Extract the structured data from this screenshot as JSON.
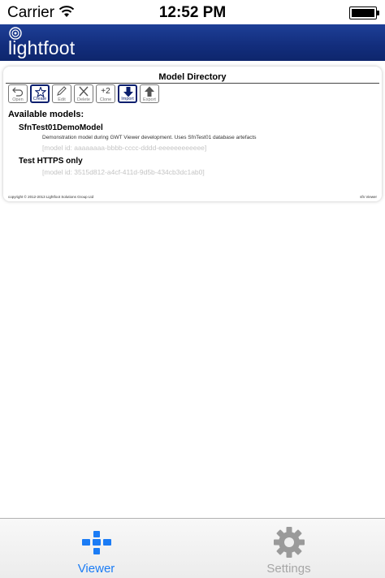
{
  "status_bar": {
    "carrier": "Carrier",
    "time": "12:52 PM"
  },
  "header": {
    "logo_text": "lightfoot"
  },
  "page": {
    "title": "Model Directory"
  },
  "toolbar": {
    "buttons": [
      {
        "label": "Open",
        "icon": "undo-arrow-icon",
        "active": false
      },
      {
        "label": "Create",
        "icon": "star-icon",
        "active": true
      },
      {
        "label": "Edit",
        "icon": "pencil-icon",
        "active": false
      },
      {
        "label": "Delete",
        "icon": "x-icon",
        "active": false
      },
      {
        "label": "Clone",
        "icon": "plus-two-icon",
        "glyph": "+2",
        "active": false
      },
      {
        "label": "Import",
        "icon": "down-arrow-icon",
        "active": true
      },
      {
        "label": "Export",
        "icon": "up-arrow-icon",
        "active": false
      }
    ]
  },
  "models": {
    "heading": "Available models:",
    "items": [
      {
        "name": "SfnTest01DemoModel",
        "description": "Demonstration model during GWT Viewer development. Uses SfnTest01 database artefacts",
        "model_id": "[model id: aaaaaaaa-bbbb-cccc-dddd-eeeeeeeeeeee]"
      },
      {
        "name": "Test HTTPS only",
        "description": "",
        "model_id": "[model id: 3515d812-a4cf-411d-9d5b-434cb3dc1ab0]"
      }
    ]
  },
  "footer": {
    "copyright": "copyright © 2012-2013 Lightfoot Solutions Group Ltd",
    "app_name": "sfn Viewer"
  },
  "tabbar": {
    "tabs": [
      {
        "label": "Viewer",
        "icon": "viewer-grid-icon",
        "selected": true
      },
      {
        "label": "Settings",
        "icon": "gear-icon",
        "selected": false
      }
    ]
  },
  "colors": {
    "header_blue": "#1a3a8f",
    "tab_selected": "#1b7cf5",
    "tab_unselected": "#a6a6a6",
    "model_id_gray": "#c4c4c4"
  }
}
